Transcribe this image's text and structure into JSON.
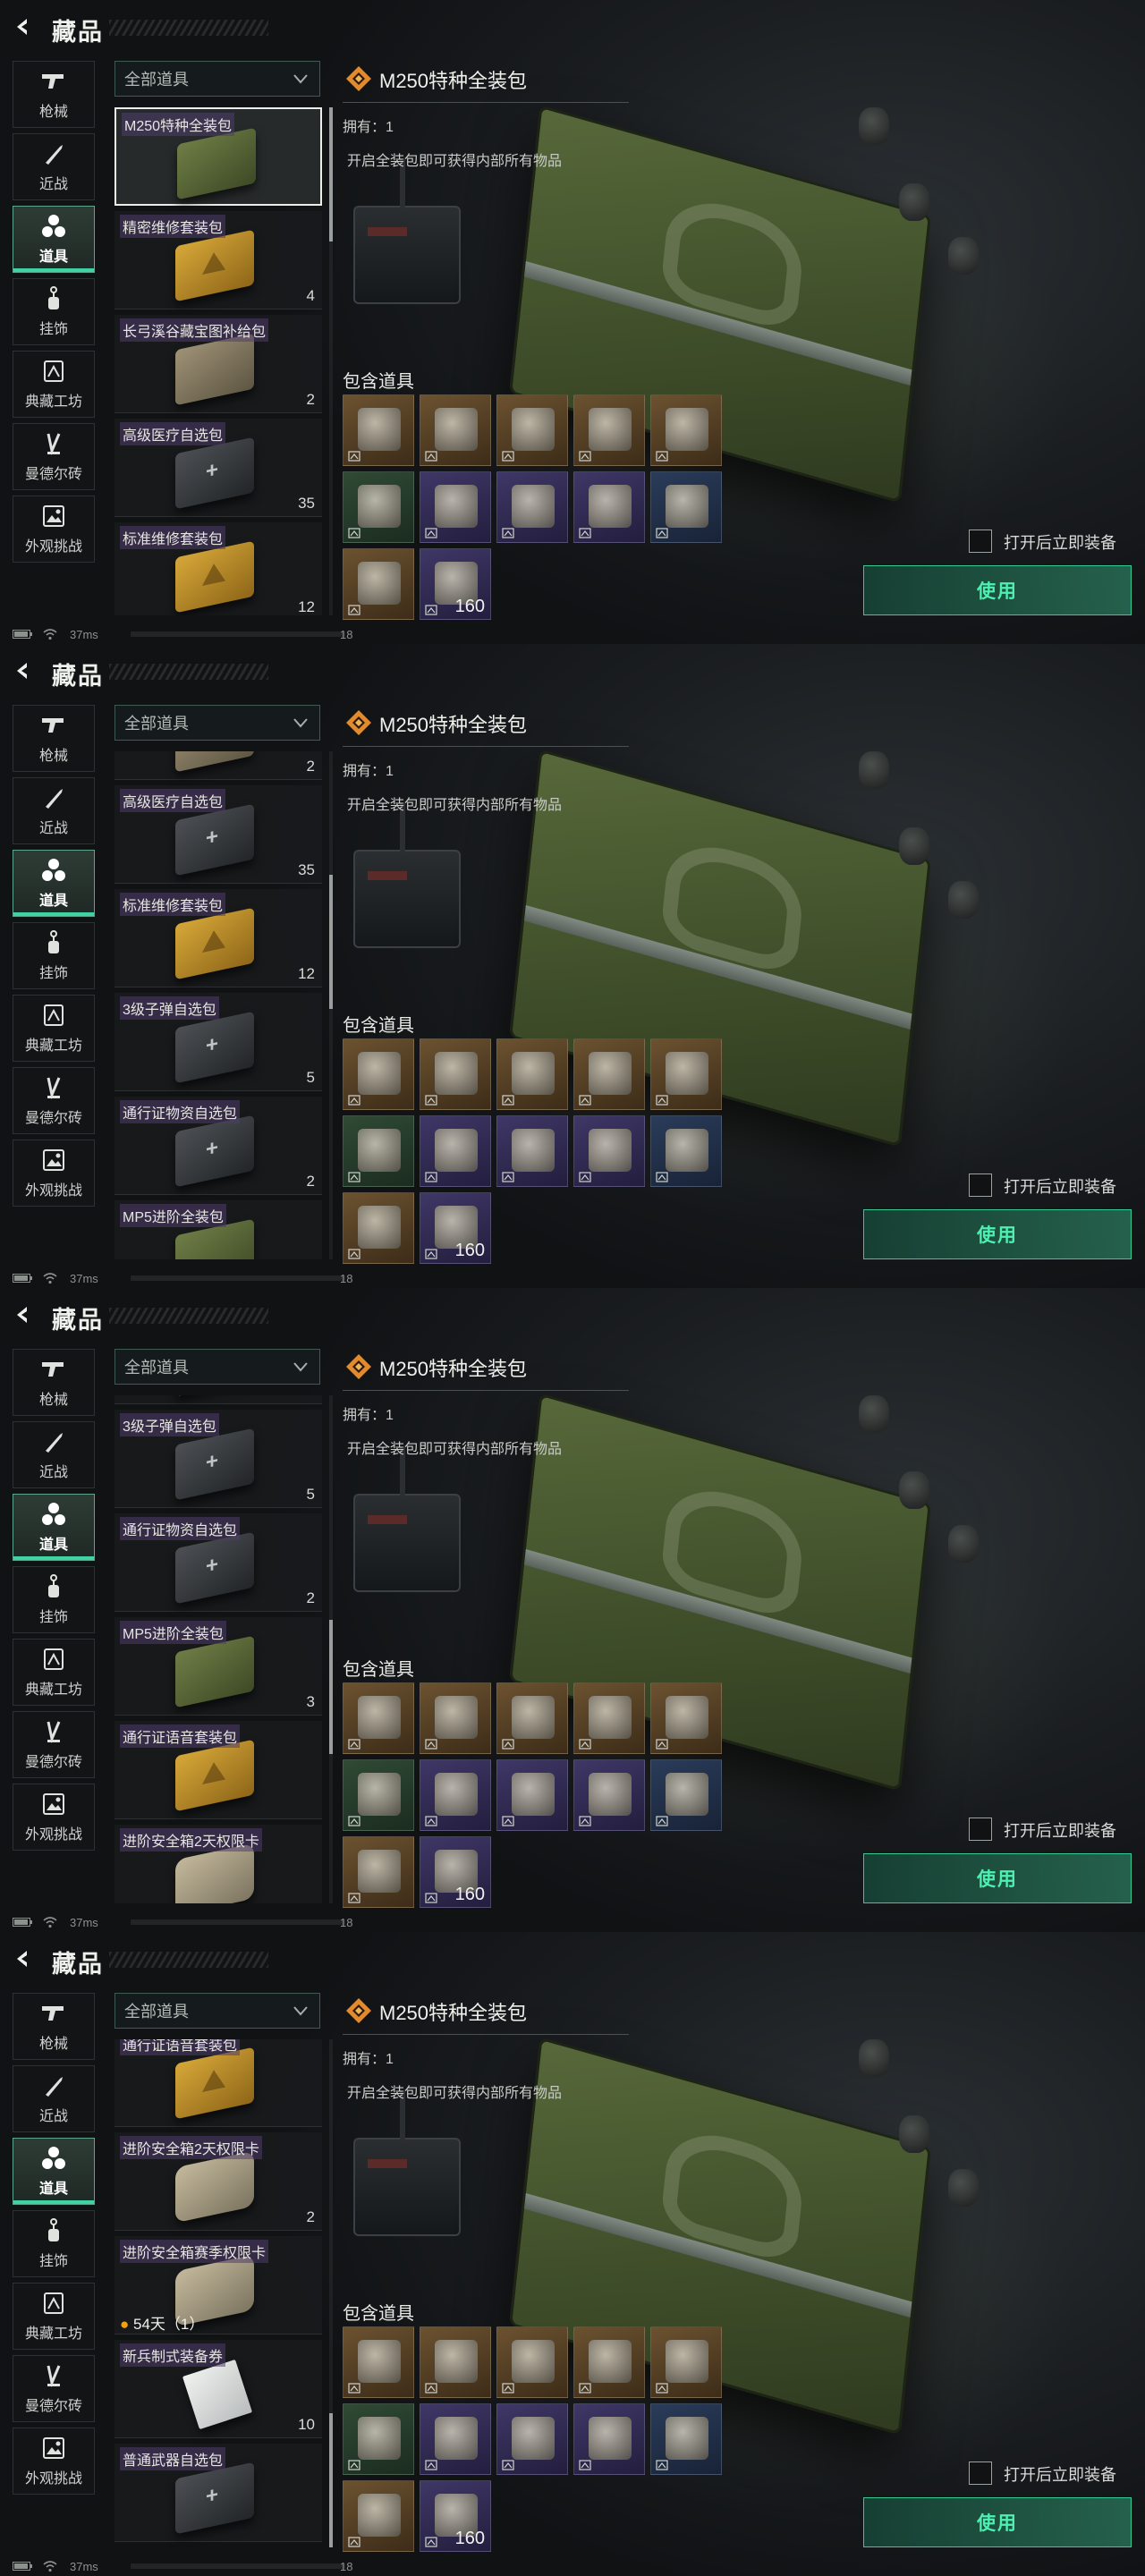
{
  "page": {
    "title": "藏品"
  },
  "nav": [
    {
      "label": "枪械",
      "icon": "gun-icon"
    },
    {
      "label": "近战",
      "icon": "knife-icon"
    },
    {
      "label": "道具",
      "icon": "items-icon",
      "active": true
    },
    {
      "label": "挂饰",
      "icon": "charm-icon"
    },
    {
      "label": "典藏工坊",
      "icon": "workshop-icon"
    },
    {
      "label": "曼德尔砖",
      "icon": "mandel-brick-icon"
    },
    {
      "label": "外观挑战",
      "icon": "appearance-challenge-icon"
    }
  ],
  "filter": {
    "value": "全部道具"
  },
  "items": [
    {
      "name": "M250特种全装包",
      "count": "",
      "style": "green"
    },
    {
      "name": "精密维修套装包",
      "count": "4",
      "style": "yellow"
    },
    {
      "name": "长弓溪谷藏宝图补给包",
      "count": "2",
      "style": "tan"
    },
    {
      "name": "高级医疗自选包",
      "count": "35",
      "style": "dark"
    },
    {
      "name": "标准维修套装包",
      "count": "12",
      "style": "yellow"
    },
    {
      "name": "3级子弹自选包",
      "count": "5",
      "style": "dark"
    },
    {
      "name": "通行证物资自选包",
      "count": "2",
      "style": "dark"
    },
    {
      "name": "MP5进阶全装包",
      "count": "3",
      "style": "green"
    },
    {
      "name": "通行证语音套装包",
      "count": "",
      "style": "yellow"
    },
    {
      "name": "进阶安全箱2天权限卡",
      "count": "2",
      "style": "case"
    },
    {
      "name": "进阶安全箱赛季权限卡",
      "count": "",
      "style": "case",
      "tag": "54天（1）"
    },
    {
      "name": "新兵制式装备券",
      "count": "10",
      "style": "paper"
    },
    {
      "name": "普通武器自选包",
      "count": "",
      "style": "dark"
    }
  ],
  "detail": {
    "title": "M250特种全装包",
    "owned": "拥有：1",
    "description": "开启全装包即可获得内部所有物品",
    "contains_title": "包含道具",
    "contents": [
      {
        "icon": "machine-gun-icon",
        "rarity": "gold",
        "count": ""
      },
      {
        "icon": "backpack-icon",
        "rarity": "gold",
        "count": ""
      },
      {
        "icon": "chest-rig-icon",
        "rarity": "gold",
        "count": ""
      },
      {
        "icon": "helmet-icon",
        "rarity": "gold",
        "count": ""
      },
      {
        "icon": "body-armor-icon",
        "rarity": "gold",
        "count": ""
      },
      {
        "icon": "syringe-icon",
        "rarity": "green",
        "count": ""
      },
      {
        "icon": "repair-kit-icon",
        "rarity": "purple",
        "count": ""
      },
      {
        "icon": "injector-icon",
        "rarity": "purple",
        "count": ""
      },
      {
        "icon": "armor-repair-icon",
        "rarity": "purple",
        "count": ""
      },
      {
        "icon": "helmet-repair-icon",
        "rarity": "blue",
        "count": ""
      },
      {
        "icon": "medkit-icon",
        "rarity": "gold",
        "count": ""
      },
      {
        "icon": "ammo-box-icon",
        "rarity": "purple",
        "count": "160"
      }
    ]
  },
  "equip_toggle": {
    "label": "打开后立即装备"
  },
  "use_button": {
    "label": "使用"
  },
  "status": {
    "ping": "37ms",
    "fps": "18"
  },
  "accent": {
    "teal": "#3fd3a3",
    "gold": "#e38a2f"
  },
  "screens": [
    {
      "list_scroll_fraction": 0.0
    },
    {
      "list_scroll_fraction": 0.33
    },
    {
      "list_scroll_fraction": 0.6
    },
    {
      "list_scroll_fraction": 1.0
    }
  ]
}
